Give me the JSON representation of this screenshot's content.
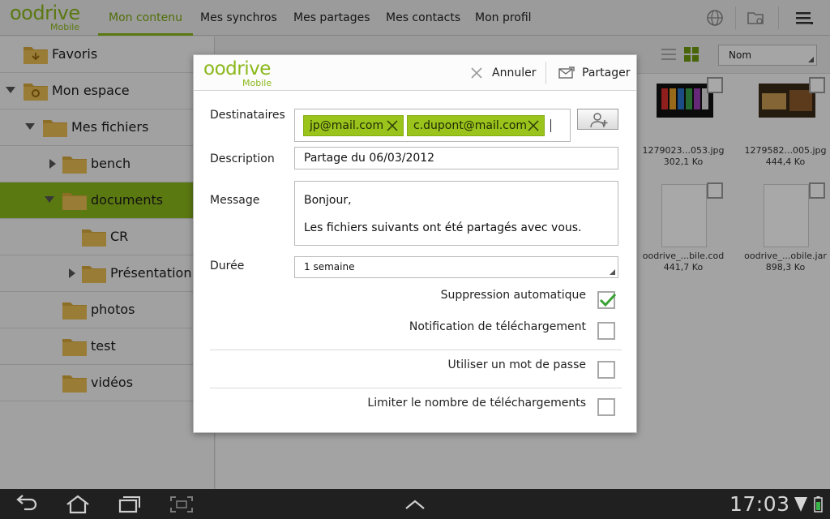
{
  "app": {
    "logo_text": "oodrive",
    "logo_sub": "Mobile",
    "brand_color": "#8ab81b"
  },
  "nav_tabs": [
    {
      "label": "Mon contenu",
      "active": true
    },
    {
      "label": "Mes synchros"
    },
    {
      "label": "Mes partages"
    },
    {
      "label": "Mes contacts"
    },
    {
      "label": "Mon profil"
    }
  ],
  "top_icons": [
    "globe-icon",
    "folder-sync-icon",
    "menu-icon"
  ],
  "sidebar": {
    "items": [
      {
        "label": "Favoris",
        "icon": "favorites-folder-icon"
      },
      {
        "label": "Mon espace",
        "icon": "home-folder-icon",
        "expanded": true
      },
      {
        "label": "Mes fichiers",
        "expanded": true
      },
      {
        "label": "bench",
        "collapsed": true
      },
      {
        "label": "documents",
        "expanded": true,
        "selected": true
      },
      {
        "label": "CR"
      },
      {
        "label": "Présentation",
        "collapsed": true
      },
      {
        "label": "photos"
      },
      {
        "label": "test"
      },
      {
        "label": "vidéos"
      }
    ]
  },
  "main": {
    "sort_value": "Nom",
    "files": [
      {
        "name": "1279023...053.jpg",
        "size": "302,1 Ko",
        "thumb": "image"
      },
      {
        "name": "1279582...005.jpg",
        "size": "444,4 Ko",
        "thumb": "image"
      },
      {
        "name": "oodrive_...bile.cod",
        "size": "441,7 Ko",
        "thumb": "document"
      },
      {
        "name": "oodrive_...obile.jar",
        "size": "898,3 Ko",
        "thumb": "document"
      }
    ]
  },
  "dialog": {
    "logo_text": "oodrive",
    "logo_sub": "Mobile",
    "cancel_label": "Annuler",
    "share_label": "Partager",
    "recipients_label": "Destinataires",
    "recipients": [
      "jp@mail.com",
      "c.dupont@mail.com"
    ],
    "description_label": "Description",
    "description_value": "Partage du 06/03/2012",
    "message_label": "Message",
    "message_line1": "Bonjour,",
    "message_line2": "Les fichiers suivants ont été partagés avec vous.",
    "duration_label": "Durée",
    "duration_value": "1 semaine",
    "options": [
      {
        "label": "Suppression automatique",
        "checked": true
      },
      {
        "label": "Notification de téléchargement",
        "checked": false
      },
      {
        "label": "Utiliser un mot de passe",
        "checked": false
      },
      {
        "label": "Limiter le nombre de téléchargements",
        "checked": false
      }
    ]
  },
  "system_bar": {
    "time": "17:03"
  }
}
